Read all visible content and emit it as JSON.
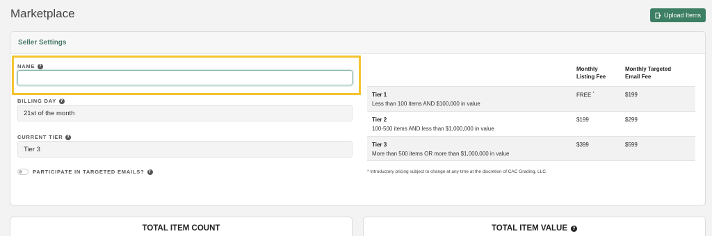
{
  "page": {
    "title": "Marketplace"
  },
  "toolbar": {
    "upload_label": "Upload Items"
  },
  "seller_settings": {
    "header": "Seller Settings",
    "name": {
      "label": "NAME",
      "value": ""
    },
    "billing_day": {
      "label": "BILLING DAY",
      "value": "21st of the month"
    },
    "current_tier": {
      "label": "CURRENT TIER",
      "value": "Tier 3"
    },
    "targeted_emails": {
      "label": "PARTICIPATE IN TARGETED EMAILS?",
      "enabled": false
    }
  },
  "tier_table": {
    "headers": {
      "listing_fee": [
        "Monthly",
        "Listing Fee"
      ],
      "email_fee": [
        "Monthly Targeted",
        "Email Fee"
      ]
    },
    "rows": [
      {
        "name": "Tier 1",
        "desc": "Less than 100 items AND $100,000 in value",
        "listing_fee": "FREE",
        "listing_fee_mark": "*",
        "email_fee": "$199"
      },
      {
        "name": "Tier 2",
        "desc": "100-500 items AND less than $1,000,000 in value",
        "listing_fee": "$199",
        "listing_fee_mark": "",
        "email_fee": "$299"
      },
      {
        "name": "Tier 3",
        "desc": "More than 500 items OR more than $1,000,000 in value",
        "listing_fee": "$399",
        "listing_fee_mark": "",
        "email_fee": "$599"
      }
    ],
    "footnote": "* Introductory pricing subject to change at any time at the discretion of CAC Grading, LLC."
  },
  "stats": {
    "total_item_count": "TOTAL ITEM COUNT",
    "total_item_value": "TOTAL ITEM VALUE"
  },
  "colors": {
    "accent": "#3d7f64",
    "highlight": "#f4c430",
    "header_text": "#4a7a67"
  }
}
